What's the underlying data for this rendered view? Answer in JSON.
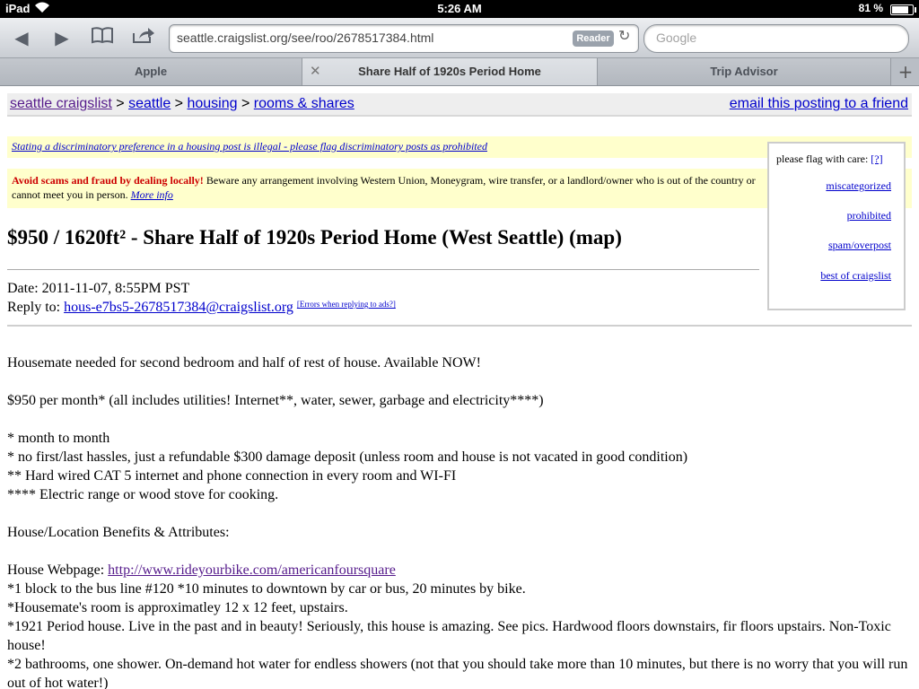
{
  "status": {
    "device": "iPad",
    "time": "5:26 AM",
    "battery": "81 %",
    "battery_level": 0.81
  },
  "toolbar": {
    "url": "seattle.craigslist.org/see/roo/2678517384.html",
    "reader_label": "Reader",
    "search_placeholder": "Google"
  },
  "tabs": [
    {
      "label": "Apple"
    },
    {
      "label": "Share Half of 1920s Period Home"
    },
    {
      "label": "Trip Advisor"
    }
  ],
  "breadcrumb": {
    "home": "seattle craigslist",
    "sep": ">",
    "city": "seattle",
    "section": "housing",
    "category": "rooms & shares",
    "email_link": "email this posting to a friend"
  },
  "notice": {
    "discrimination": "Stating a discriminatory preference in a housing post is illegal - please flag discriminatory posts as prohibited",
    "scam_bold": "Avoid scams and fraud by dealing locally!",
    "scam_text": " Beware any arrangement involving Western Union, Moneygram, wire transfer, or a landlord/owner who is out of the country or cannot meet you in person. ",
    "more_info": "More info"
  },
  "flag": {
    "title": "please flag with care:",
    "help": "[?]",
    "items": [
      "miscategorized",
      "prohibited",
      "spam/overpost",
      "best of craigslist"
    ]
  },
  "post": {
    "title": "$950 / 1620ft² - Share Half of 1920s Period Home (West Seattle) (map)",
    "date": "Date: 2011-11-07, 8:55PM PST",
    "reply_label": "Reply to:",
    "reply_email": "hous-e7bs5-2678517384@craigslist.org",
    "errors_link": "[Errors when replying to ads?]",
    "lines": [
      "Housemate needed for second bedroom and half of rest of house. Available NOW!",
      "$950 per month* (all includes utilities! Internet**, water, sewer, garbage and electricity****)",
      "* month to month",
      "* no first/last hassles, just a refundable $300 damage deposit (unless room and house is not vacated in good condition)",
      "** Hard wired CAT 5 internet and phone connection in every room and WI-FI",
      "**** Electric range or wood stove for cooking.",
      "House/Location Benefits & Attributes:",
      "House Webpage: ",
      "*1 block to the bus line #120 *10 minutes to downtown by car or bus, 20 minutes by bike.",
      "*Housemate's room is approximatley 12 x 12 feet, upstairs.",
      "*1921 Period house. Live in the past and in beauty! Seriously, this house is amazing. See pics. Hardwood floors downstairs, fir floors upstairs. Non-Toxic house!",
      "*2 bathrooms, one shower. On-demand hot water for endless showers (not that you should take more than 10 minutes, but there is no worry that you will run out of hot water!)"
    ],
    "webpage_url": "http://www.rideyourbike.com/americanfoursquare"
  }
}
